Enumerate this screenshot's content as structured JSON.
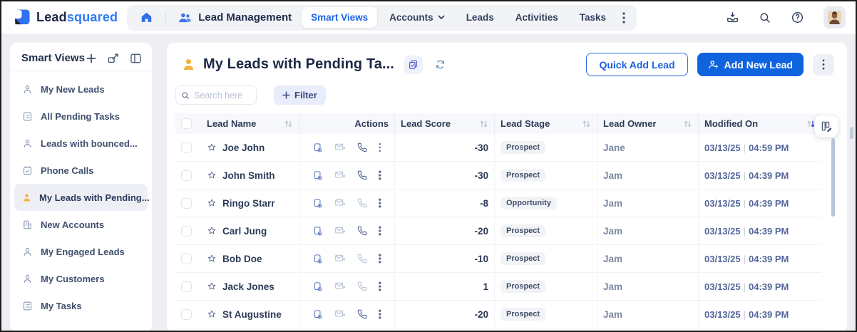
{
  "brand": {
    "name_dark": "Lead",
    "name_blue": "squared"
  },
  "navbar": {
    "app_name": "Lead Management",
    "tabs": [
      {
        "label": "Smart Views",
        "active": true
      },
      {
        "label": "Accounts",
        "has_dropdown": true
      },
      {
        "label": "Leads"
      },
      {
        "label": "Activities"
      },
      {
        "label": "Tasks"
      }
    ]
  },
  "sidebar": {
    "title": "Smart Views",
    "items": [
      {
        "label": "My New Leads",
        "icon": "person-icon",
        "active": false
      },
      {
        "label": "All Pending Tasks",
        "icon": "checklist-icon",
        "active": false
      },
      {
        "label": "Leads with bounced...",
        "icon": "person-icon",
        "active": false
      },
      {
        "label": "Phone Calls",
        "icon": "calendar-check-icon",
        "active": false
      },
      {
        "label": "My Leads with Pending...",
        "icon": "person-filled-icon",
        "active": true
      },
      {
        "label": "New Accounts",
        "icon": "building-icon",
        "active": false
      },
      {
        "label": "My Engaged Leads",
        "icon": "person-icon",
        "active": false
      },
      {
        "label": "My Customers",
        "icon": "person-icon",
        "active": false
      },
      {
        "label": "My Tasks",
        "icon": "checklist-icon",
        "active": false
      }
    ]
  },
  "main": {
    "title": "My Leads with Pending Ta...",
    "quick_add_label": "Quick Add Lead",
    "add_new_label": "Add New Lead",
    "search_placeholder": "Search here",
    "filter_label": "Filter"
  },
  "table": {
    "columns": {
      "name": "Lead Name",
      "actions": "Actions",
      "score": "Lead Score",
      "stage": "Lead Stage",
      "owner": "Lead Owner",
      "modified": "Modified On"
    },
    "sorted_by": "Modified On",
    "rows": [
      {
        "name": "Joe John",
        "score": "-30",
        "stage": "Prospect",
        "owner": "Jane",
        "date": "03/13/25",
        "time": "04:59 PM",
        "phone_active": true
      },
      {
        "name": "John Smith",
        "score": "-30",
        "stage": "Prospect",
        "owner": "Jam",
        "date": "03/13/25",
        "time": "04:39 PM",
        "phone_active": true
      },
      {
        "name": "Ringo Starr",
        "score": "-8",
        "stage": "Opportunity",
        "owner": "Jam",
        "date": "03/13/25",
        "time": "04:39 PM",
        "phone_active": false
      },
      {
        "name": "Carl Jung",
        "score": "-20",
        "stage": "Prospect",
        "owner": "Jam",
        "date": "03/13/25",
        "time": "04:39 PM",
        "phone_active": true
      },
      {
        "name": "Bob Doe",
        "score": "-10",
        "stage": "Prospect",
        "owner": "Jam",
        "date": "03/13/25",
        "time": "04:39 PM",
        "phone_active": false
      },
      {
        "name": "Jack Jones",
        "score": "1",
        "stage": "Prospect",
        "owner": "Jam",
        "date": "03/13/25",
        "time": "04:39 PM",
        "phone_active": false
      },
      {
        "name": "St Augustine",
        "score": "-20",
        "stage": "Prospect",
        "owner": "Jam",
        "date": "03/13/25",
        "time": "04:39 PM",
        "phone_active": true
      }
    ]
  },
  "icons": {
    "top": [
      "home-icon",
      "users-icon",
      "chevron-down-icon",
      "kebab-icon",
      "inbox-import-icon",
      "search-icon",
      "help-icon",
      "avatar"
    ],
    "row_actions": [
      "note-add-icon",
      "email-send-icon",
      "phone-icon",
      "kebab-icon"
    ],
    "table": [
      "sort-icon",
      "columns-edit-icon",
      "star-icon",
      "checkbox"
    ]
  },
  "colors": {
    "accent_blue": "#0F63DE",
    "link_blue": "#2F7BF5",
    "navy_text": "#1B2845",
    "yellow_person": "#F2B33D",
    "pill_bg": "#F2F3F7",
    "page_bg": "#EDEFF3"
  }
}
